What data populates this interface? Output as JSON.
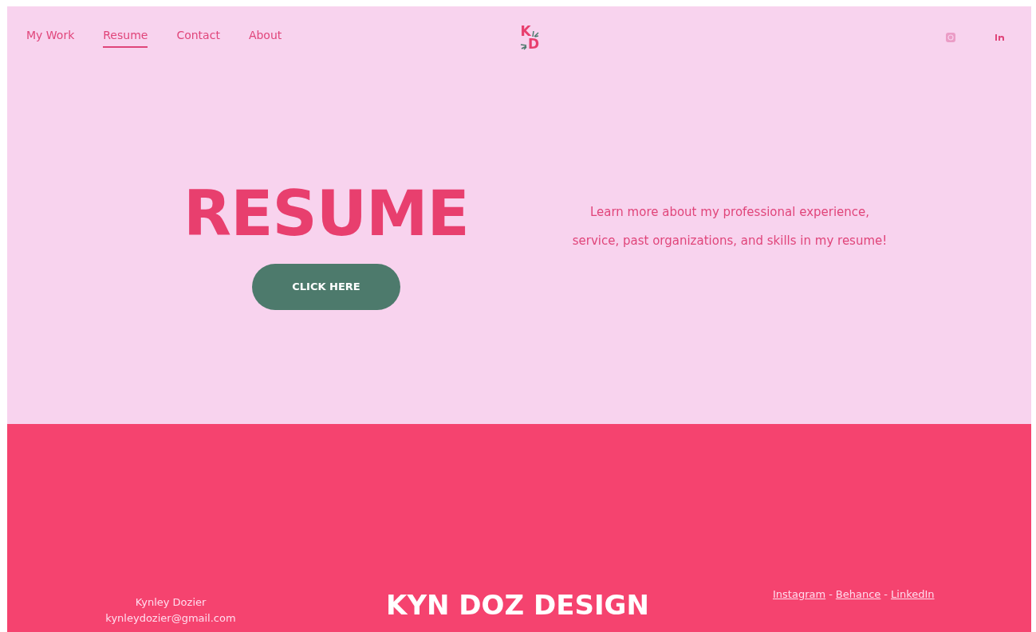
{
  "nav": [
    {
      "label": "My Work",
      "selected": false
    },
    {
      "label": "Resume",
      "selected": true
    },
    {
      "label": "Contact",
      "selected": false
    },
    {
      "label": "About",
      "selected": false
    }
  ],
  "logo": {
    "letters": [
      "K",
      "D"
    ]
  },
  "hero": {
    "title": "RESUME",
    "button": "CLICK HERE",
    "text": "Learn more about my professional experience, service, past organizations, and skills in my resume!"
  },
  "footer": {
    "name": "Kynley Dozier",
    "email": "kynleydozier@gmail.com",
    "brand": "KYN DOZ DESIGN",
    "links": [
      "Instagram",
      "Behance",
      "LinkedIn"
    ],
    "separator": "-"
  }
}
